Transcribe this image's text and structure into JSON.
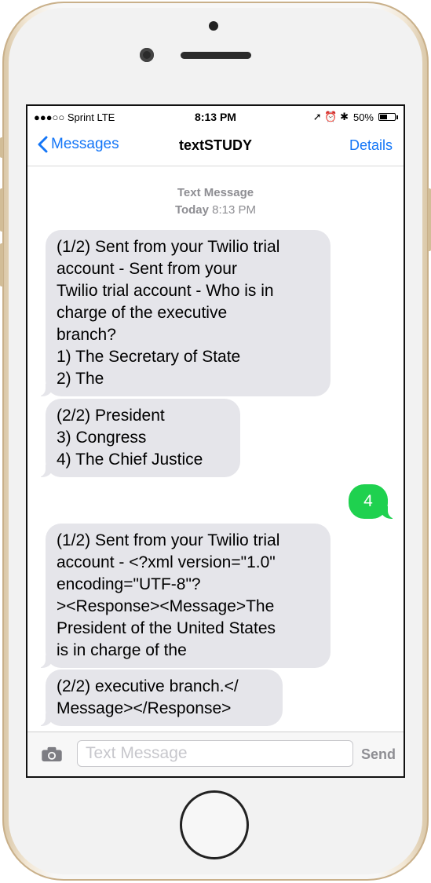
{
  "status_bar": {
    "carrier": "●●●○○ Sprint  LTE",
    "time": "8:13 PM",
    "indicators": "➚ ⏰ ✱",
    "battery": "50%",
    "battery_level": 0.5
  },
  "nav": {
    "back_label": "Messages",
    "title": "textSTUDY",
    "details_label": "Details"
  },
  "meta": {
    "type": "Text Message",
    "day": "Today",
    "time": "8:13 PM"
  },
  "messages": [
    {
      "direction": "incoming",
      "text": "(1/2) Sent from your Twilio trial\naccount - Sent from your\nTwilio trial account - Who is in\ncharge of the executive\nbranch?\n1) The Secretary of State\n2) The"
    },
    {
      "direction": "incoming",
      "text": "(2/2) President\n3) Congress\n4) The Chief Justice"
    },
    {
      "direction": "outgoing",
      "text": "4"
    },
    {
      "direction": "incoming",
      "text": "(1/2) Sent from your Twilio trial\naccount - <?xml version=\"1.0\"\nencoding=\"UTF-8\"?\n><Response><Message>The\nPresident of the United States\nis in charge of the"
    },
    {
      "direction": "incoming",
      "text": "(2/2) executive branch.</\nMessage></Response>"
    }
  ],
  "input": {
    "placeholder": "Text Message",
    "send_label": "Send",
    "camera_icon": "camera-icon"
  }
}
